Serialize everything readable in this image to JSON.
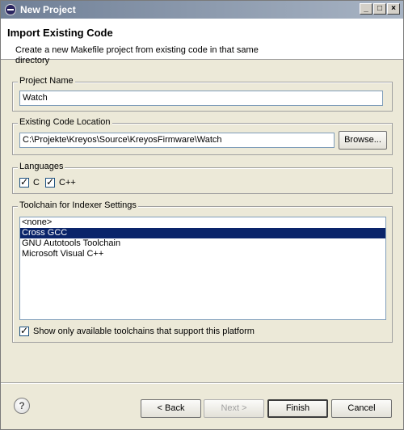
{
  "window": {
    "title": "New Project"
  },
  "header": {
    "title": "Import Existing Code",
    "description": "Create a new Makefile project from existing code in that same directory"
  },
  "project_name": {
    "label": "Project Name",
    "value": "Watch"
  },
  "code_location": {
    "label": "Existing Code Location",
    "value": "C:\\Projekte\\Kreyos\\Source\\KreyosFirmware\\Watch",
    "browse_label": "Browse..."
  },
  "languages": {
    "label": "Languages",
    "items": [
      {
        "label": "C",
        "checked": true
      },
      {
        "label": "C++",
        "checked": true
      }
    ]
  },
  "toolchain": {
    "label": "Toolchain for Indexer Settings",
    "items": [
      {
        "label": "<none>",
        "selected": false
      },
      {
        "label": "Cross GCC",
        "selected": true
      },
      {
        "label": "GNU Autotools Toolchain",
        "selected": false
      },
      {
        "label": "Microsoft Visual C++",
        "selected": false
      }
    ],
    "filter_label": "Show only available toolchains that support this platform",
    "filter_checked": true
  },
  "buttons": {
    "back": "< Back",
    "next": "Next >",
    "finish": "Finish",
    "cancel": "Cancel"
  },
  "colors": {
    "selection": "#0a246a",
    "dialog_background": "#ece9d8"
  }
}
